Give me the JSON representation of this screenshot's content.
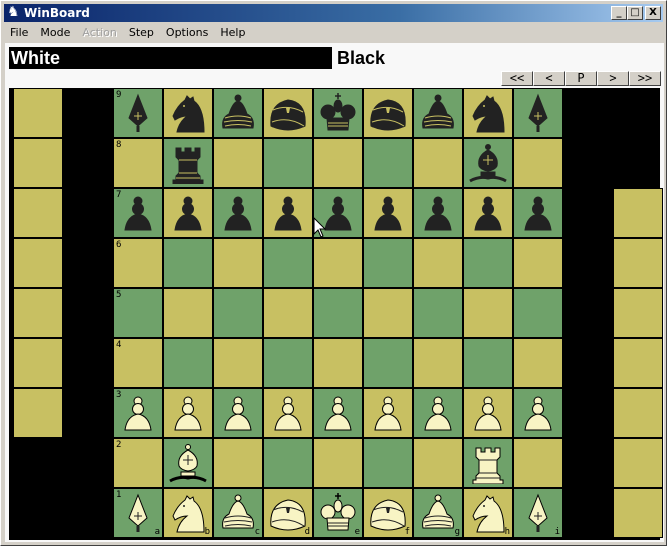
{
  "window": {
    "title": "WinBoard",
    "buttons": [
      "_",
      "□",
      "X"
    ]
  },
  "menu": [
    {
      "label": "File",
      "enabled": true
    },
    {
      "label": "Mode",
      "enabled": true
    },
    {
      "label": "Action",
      "enabled": false
    },
    {
      "label": "Step",
      "enabled": true
    },
    {
      "label": "Options",
      "enabled": true
    },
    {
      "label": "Help",
      "enabled": true
    }
  ],
  "clocks": {
    "white": "White",
    "black": "Black",
    "active": "white"
  },
  "nav": [
    "<<",
    "<",
    "P",
    ">",
    ">>"
  ],
  "board": {
    "files": [
      "a",
      "b",
      "c",
      "d",
      "e",
      "f",
      "g",
      "h",
      "i"
    ],
    "ranks": [
      "9",
      "8",
      "7",
      "6",
      "5",
      "4",
      "3",
      "2",
      "1"
    ],
    "colors": {
      "light": "#c8c062",
      "dark": "#6fa26a"
    },
    "rows": [
      [
        "bL",
        "bN",
        "bS",
        "bG",
        "bK",
        "bG",
        "bS",
        "bN",
        "bL"
      ],
      [
        "",
        "bR",
        "",
        "",
        "",
        "",
        "",
        "bB",
        ""
      ],
      [
        "bP",
        "bP",
        "bP",
        "bP",
        "bP",
        "bP",
        "bP",
        "bP",
        "bP"
      ],
      [
        "",
        "",
        "",
        "",
        "",
        "",
        "",
        "",
        ""
      ],
      [
        "",
        "",
        "",
        "",
        "",
        "",
        "",
        "",
        ""
      ],
      [
        "",
        "",
        "",
        "",
        "",
        "",
        "",
        "",
        ""
      ],
      [
        "wP",
        "wP",
        "wP",
        "wP",
        "wP",
        "wP",
        "wP",
        "wP",
        "wP"
      ],
      [
        "",
        "wB",
        "",
        "",
        "",
        "",
        "",
        "wR",
        ""
      ],
      [
        "wL",
        "wN",
        "wS",
        "wG",
        "wK",
        "wG",
        "wS",
        "wN",
        "wL"
      ]
    ],
    "piece_names": {
      "L": "lance",
      "N": "knight",
      "S": "silver-general",
      "G": "gold-general",
      "K": "king",
      "R": "rook",
      "B": "bishop",
      "P": "pawn"
    }
  },
  "holdings": {
    "left_squares": 7,
    "right_squares": 7
  }
}
